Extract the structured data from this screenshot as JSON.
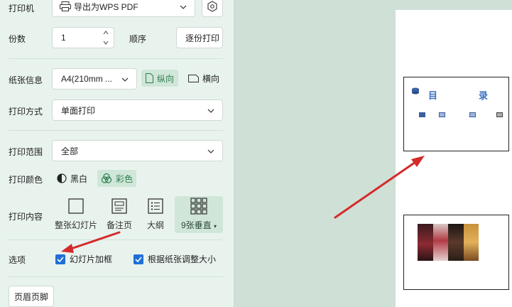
{
  "printer": {
    "label": "打印机",
    "value": "导出为WPS PDF"
  },
  "copies": {
    "label": "份数",
    "value": "1"
  },
  "order": {
    "label": "顺序",
    "value": "逐份打印"
  },
  "paper": {
    "label": "纸张信息",
    "value": "A4(210mm ...",
    "portrait": "纵向",
    "landscape": "横向"
  },
  "print_mode": {
    "label": "打印方式",
    "value": "单面打印"
  },
  "print_range": {
    "label": "打印范围",
    "value": "全部"
  },
  "print_color": {
    "label": "打印颜色",
    "mono": "黑白",
    "color": "彩色"
  },
  "print_content": {
    "label": "打印内容",
    "items": [
      "整张幻灯片",
      "备注页",
      "大纲",
      "9张垂直"
    ]
  },
  "options": {
    "label": "选项",
    "frame_slides": "幻灯片加框",
    "fit_paper": "根据纸张调整大小"
  },
  "header_footer": "页眉页脚",
  "preview": {
    "slide1_title_left": "目",
    "slide1_title_right": "录"
  },
  "colors": {
    "accent_green": "#2e7d4f",
    "checkbox_blue": "#1f6fd8",
    "arrow_red": "#d42b2b",
    "panel_bg": "#e9f3ee",
    "preview_bg": "#cfe0d7"
  }
}
